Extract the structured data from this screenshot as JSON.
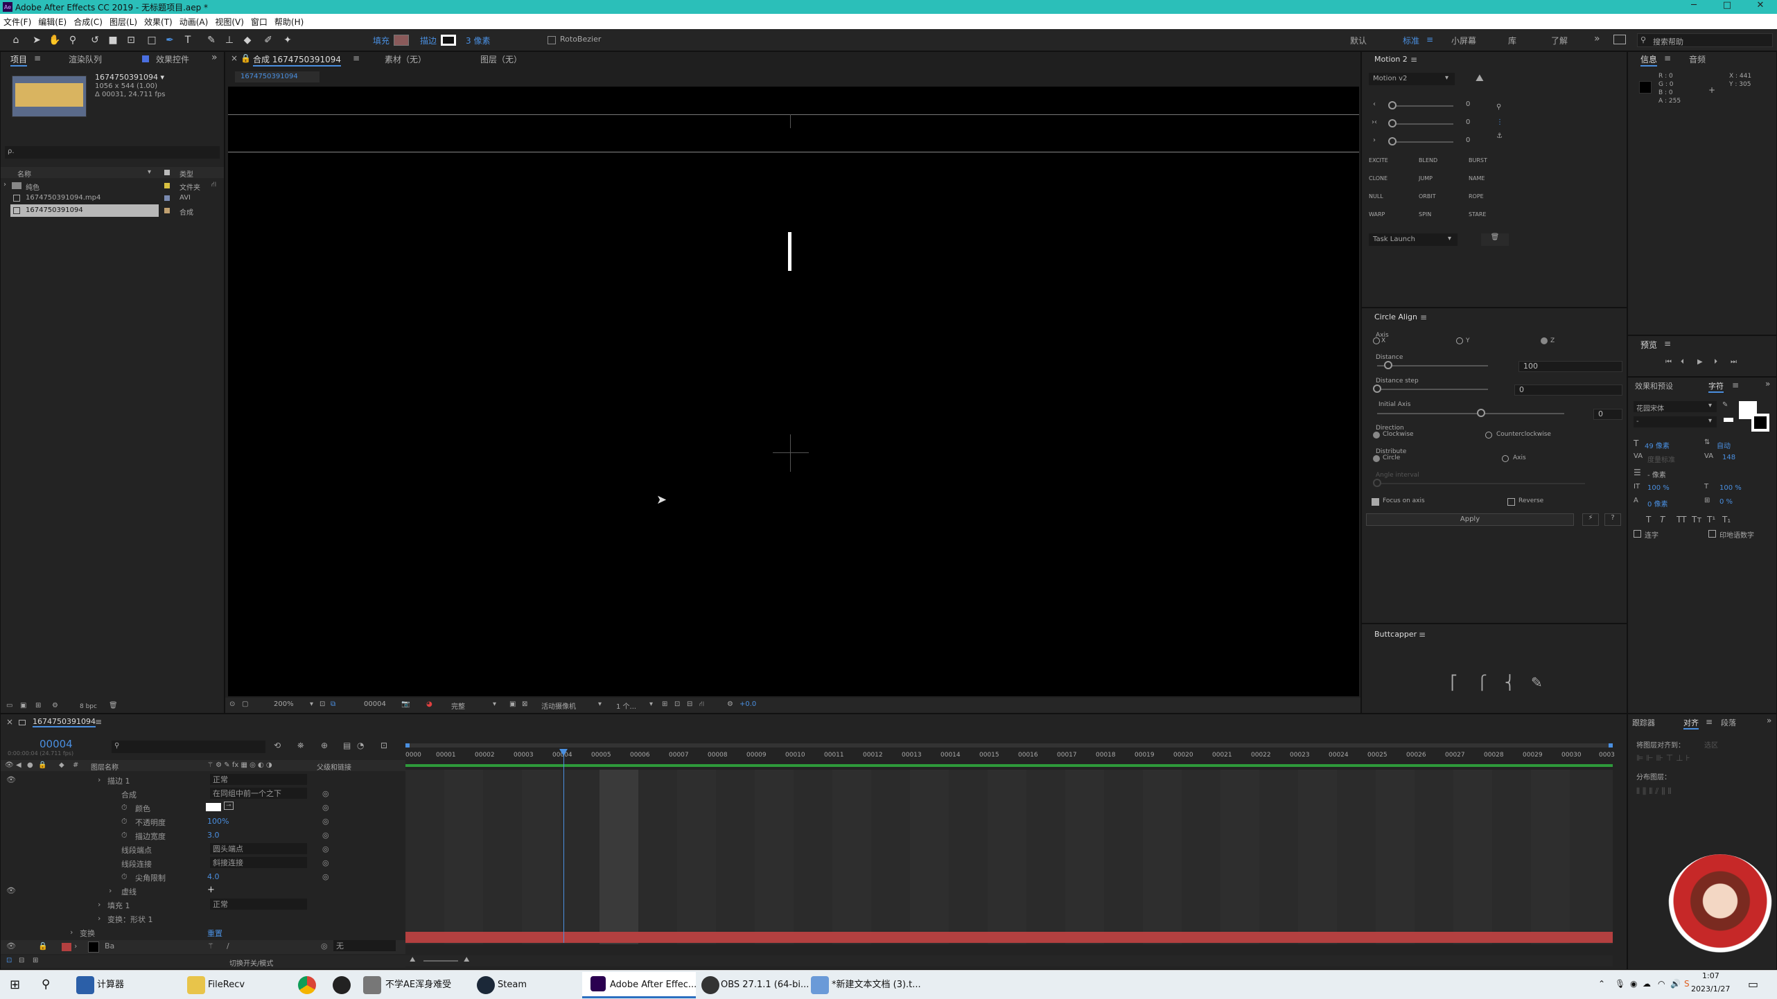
{
  "window": {
    "title": "Adobe After Effects CC 2019 - 无标题项目.aep *",
    "min": "─",
    "max": "□",
    "close": "✕"
  },
  "menu": [
    "文件(F)",
    "编辑(E)",
    "合成(C)",
    "图层(L)",
    "效果(T)",
    "动画(A)",
    "视图(V)",
    "窗口",
    "帮助(H)"
  ],
  "toolbar": {
    "fill": "填充",
    "stroke": "描边",
    "stroke_width": "3 像素",
    "roto": "RotoBezier",
    "workspaces": [
      "默认",
      "标准",
      "小屏幕",
      "库",
      "了解"
    ],
    "search_placeholder": "搜索帮助",
    "active_ws": "标准"
  },
  "project": {
    "tab": "项目",
    "tab2": "渲染队列",
    "tab3": "效果控件",
    "item_name": "1674750391094 ▾",
    "item_info1": "1056 x 544 (1.00)",
    "item_info2": "Δ 00031, 24.711 fps",
    "search_placeholder": "ρ.",
    "col_name": "名称",
    "col_type": "类型",
    "rows": [
      {
        "name": "纯色",
        "type": "文件夹"
      },
      {
        "name": "1674750391094.mp4",
        "type": "AVI"
      },
      {
        "name": "1674750391094",
        "type": "合成"
      }
    ],
    "bpc": "8 bpc"
  },
  "comp": {
    "tab": "合成 1674750391094",
    "tab_footage": "素材（无）",
    "tab_layer": "图层（无）",
    "sub_tab": "1674750391094",
    "zoom": "200%",
    "frame": "00004",
    "quality": "完整",
    "camera": "活动摄像机",
    "views": "1 个...",
    "exposure": "+0.0"
  },
  "motion": {
    "tab": "Motion 2",
    "preset": "Motion v2",
    "values": [
      "0",
      "0",
      "0"
    ],
    "buttons": [
      "EXCITE",
      "BLEND",
      "BURST",
      "CLONE",
      "JUMP",
      "NAME",
      "NULL",
      "ORBIT",
      "ROPE",
      "WARP",
      "SPIN",
      "STARE"
    ],
    "task": "Task Launch"
  },
  "circle_align": {
    "tab": "Circle Align",
    "axis": "Axis",
    "axis_x": "X",
    "axis_y": "Y",
    "axis_z": "Z",
    "distance": "Distance",
    "distance_val": "100",
    "distance_step": "Distance step",
    "distance_step_val": "0",
    "initial_axis": "Initial Axis",
    "initial_axis_val": "0",
    "direction": "Direction",
    "clockwise": "Clockwise",
    "counter": "Counterclockwise",
    "distribute": "Distribute",
    "circle": "Circle",
    "axis_opt": "Axis",
    "angle": "Angle interval",
    "focus": "Focus on axis",
    "reverse": "Reverse",
    "apply": "Apply"
  },
  "buttcapper": {
    "tab": "Buttcapper"
  },
  "info": {
    "tab": "信息",
    "tab2": "音频",
    "r": "R : 0",
    "g": "G : 0",
    "b": "B : 0",
    "a": "A : 255",
    "x": "X : 441",
    "y": "Y : 305"
  },
  "preview": {
    "tab": "预览"
  },
  "character": {
    "tab": "效果和预设",
    "tab2": "字符",
    "font": "花园宋体",
    "style": "-",
    "size": "49 像素",
    "leading": "自动",
    "kerning": "度量标准",
    "tracking": "148",
    "stroke": "- 像素",
    "vscale": "100 %",
    "hscale": "100 %",
    "baseline": "0 像素",
    "tsume": "0 %",
    "ligature": "连字",
    "hindi": "印地语数字"
  },
  "align": {
    "tab": "对齐",
    "tab_tracker": "跟踪器",
    "tab3": "段落",
    "align_to": "将图层对齐到：",
    "align_to_val": "选区",
    "distribute": "分布图层："
  },
  "timeline": {
    "tab": "1674750391094",
    "timecode": "00004",
    "fps": "0:00:00:04 (24.711 fps)",
    "col_layer": "图层名称",
    "col_parent": "父级和链接",
    "ruler": [
      "0000",
      "00001",
      "00002",
      "00003",
      "00004",
      "00005",
      "00006",
      "00007",
      "00008",
      "00009",
      "00010",
      "00011",
      "00012",
      "00013",
      "00014",
      "00015",
      "00016",
      "00017",
      "00018",
      "00019",
      "00020",
      "00021",
      "00022",
      "00023",
      "00024",
      "00025",
      "00026",
      "00027",
      "00028",
      "00029",
      "00030",
      "0003"
    ],
    "rows": [
      {
        "name": "描边 1",
        "val": "正常"
      },
      {
        "name": "合成",
        "val": "在同组中前一个之下"
      },
      {
        "name": "颜色",
        "val": ""
      },
      {
        "name": "不透明度",
        "val": "100%"
      },
      {
        "name": "描边宽度",
        "val": "3.0"
      },
      {
        "name": "线段端点",
        "val": "圆头端点"
      },
      {
        "name": "线段连接",
        "val": "斜接连接"
      },
      {
        "name": "尖角限制",
        "val": "4.0"
      },
      {
        "name": "虚线",
        "val": "+"
      },
      {
        "name": "填充 1",
        "val": "正常"
      },
      {
        "name": "变换：形状 1",
        "val": ""
      },
      {
        "name": "变换",
        "val": "重置"
      },
      {
        "name": "Ba",
        "val": "无"
      }
    ],
    "footer": "切换开关/模式"
  },
  "taskbar": {
    "items": [
      "计算器",
      "FileRecv",
      "",
      "",
      "不学AE浑身难受",
      "Steam",
      "Adobe After Effec...",
      "OBS 27.1.1 (64-bi...",
      "*新建文本文档 (3).t..."
    ],
    "time": "1:07",
    "date": "2023/1/27"
  },
  "colors": {
    "accent": "#4a8fe0",
    "titlebar": "#2bbfb9",
    "layer_red": "#b34040"
  }
}
